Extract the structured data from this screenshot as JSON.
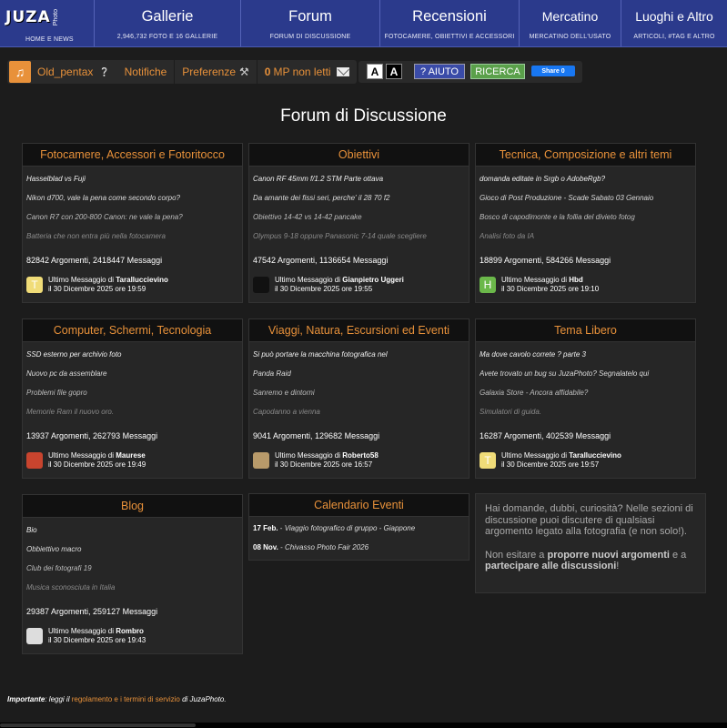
{
  "nav": {
    "logo_text": "JUZA",
    "logo_sub": "Photo",
    "home_label": "HOME E NEWS",
    "items": [
      {
        "title": "Gallerie",
        "sub": "2,946,732 FOTO E 16 GALLERIE"
      },
      {
        "title": "Forum",
        "sub": "FORUM DI DISCUSSIONE"
      },
      {
        "title": "Recensioni",
        "sub": "FOTOCAMERE, OBIETTIVI E ACCESSORI"
      },
      {
        "title": "Mercatino",
        "sub": "MERCATINO DELL'USATO"
      },
      {
        "title": "Luoghi e Altro",
        "sub": "ARTICOLI, #TAG E ALTRO"
      }
    ]
  },
  "userbar": {
    "username": "Old_pentax",
    "notifiche": "Notifiche",
    "preferenze": "Preferenze",
    "mp_count": "0",
    "mp_label": "MP non letti"
  },
  "toolbar": {
    "a_light": "A",
    "a_dark": "A",
    "aiuto": "? AIUTO",
    "ricerca": "RICERCA",
    "share": "Share 0"
  },
  "page_title": "Forum di Discussione",
  "forums": [
    {
      "title": "Fotocamere, Accessori e Fotoritocco",
      "topics": [
        "Hasselblad vs Fuji",
        "Nikon d700, vale la pena come secondo corpo?",
        "Canon R7 con 200-800 Canon: ne vale la pena?",
        "Batteria che non entra più nella fotocamera"
      ],
      "stats": "82842 Argomenti, 2418447 Messaggi",
      "last_prefix": "Ultimo Messaggio di",
      "last_user": "Taralluccievino",
      "last_date": "il 30 Dicembre 2025 ore 19:59",
      "avatar_letter": "T",
      "avatar_color": "#f0dc78"
    },
    {
      "title": "Obiettivi",
      "topics": [
        "Canon RF 45mm f/1.2 STM Parte ottava",
        "Da amante dei fissi seri, perche' il 28 70 f2",
        "Obiettivo 14-42 vs 14-42 pancake",
        "Olympus 9-18 oppure Panasonic 7-14 quale scegliere"
      ],
      "stats": "47542 Argomenti, 1136654 Messaggi",
      "last_prefix": "Ultimo Messaggio di",
      "last_user": "Gianpietro Uggeri",
      "last_date": "il 30 Dicembre 2025 ore 19:55",
      "avatar_letter": "",
      "avatar_color": "#111111"
    },
    {
      "title": "Tecnica, Composizione e altri temi",
      "topics": [
        "domanda editate in Srgb o AdobeRgb?",
        "Gioco di Post Produzione - Scade Sabato 03 Gennaio",
        "Bosco di capodimonte e la follia del divieto fotog",
        "Analisi foto da IA"
      ],
      "stats": "18899 Argomenti, 584266 Messaggi",
      "last_prefix": "Ultimo Messaggio di",
      "last_user": "Hbd",
      "last_date": "il 30 Dicembre 2025 ore 19:10",
      "avatar_letter": "H",
      "avatar_color": "#6bb84a"
    },
    {
      "title": "Computer, Schermi, Tecnologia",
      "topics": [
        "SSD esterno per archivio foto",
        "Nuovo pc da assemblare",
        "Problemi file gopro",
        "Memorie Ram il nuovo oro."
      ],
      "stats": "13937 Argomenti, 262793 Messaggi",
      "last_prefix": "Ultimo Messaggio di",
      "last_user": "Maurese",
      "last_date": "il 30 Dicembre 2025 ore 19:49",
      "avatar_letter": "",
      "avatar_color": "#c8442e"
    },
    {
      "title": "Viaggi, Natura, Escursioni ed Eventi",
      "topics": [
        "Si può portare la macchina fotografica nel",
        "Panda Raid",
        "Sanremo e dintorni",
        "Capodanno a vienna"
      ],
      "stats": "9041 Argomenti, 129682 Messaggi",
      "last_prefix": "Ultimo Messaggio di",
      "last_user": "Roberto58",
      "last_date": "il 30 Dicembre 2025 ore 16:57",
      "avatar_letter": "",
      "avatar_color": "#b89a6a"
    },
    {
      "title": "Tema Libero",
      "topics": [
        "Ma dove cavolo correte ? parte 3",
        "Avete trovato un bug su JuzaPhoto? Segnalatelo qui",
        "Galaxia Store - Ancora affidabile?",
        "Simulatori di guida."
      ],
      "stats": "16287 Argomenti, 402539 Messaggi",
      "last_prefix": "Ultimo Messaggio di",
      "last_user": "Taralluccievino",
      "last_date": "il 30 Dicembre 2025 ore 19:57",
      "avatar_letter": "T",
      "avatar_color": "#f0dc78"
    },
    {
      "title": "Blog",
      "topics": [
        "Bio",
        "Obbiettivo macro",
        "Club dei fotografi 19",
        "Musica sconosciuta in Italia"
      ],
      "stats": "29387 Argomenti, 259127 Messaggi",
      "last_prefix": "Ultimo Messaggio di",
      "last_user": "Rombro",
      "last_date": "il 30 Dicembre 2025 ore 19:43",
      "avatar_letter": "",
      "avatar_color": "#dddddd"
    }
  ],
  "calendar": {
    "title": "Calendario Eventi",
    "events": [
      {
        "date": "17 Feb.",
        "sep": " - ",
        "text": "Viaggio fotografico di gruppo - Giappone"
      },
      {
        "date": "08 Nov.",
        "sep": " - ",
        "text": "Chivasso Photo Fair 2026"
      }
    ]
  },
  "info": {
    "p1": "Hai domande, dubbi, curiosità? Nelle sezioni di discussione puoi discutere di qualsiasi argomento legato alla fotografia (e non solo!).",
    "p2_a": "Non esitare a ",
    "p2_b": "proporre nuovi argomenti",
    "p2_c": " e a ",
    "p2_d": "partecipare alle discussioni",
    "p2_e": "!"
  },
  "footer": {
    "important": "Importante",
    "text1": ": leggi il ",
    "link": "regolamento e i termini di servizio",
    "text2": " di JuzaPhoto."
  }
}
